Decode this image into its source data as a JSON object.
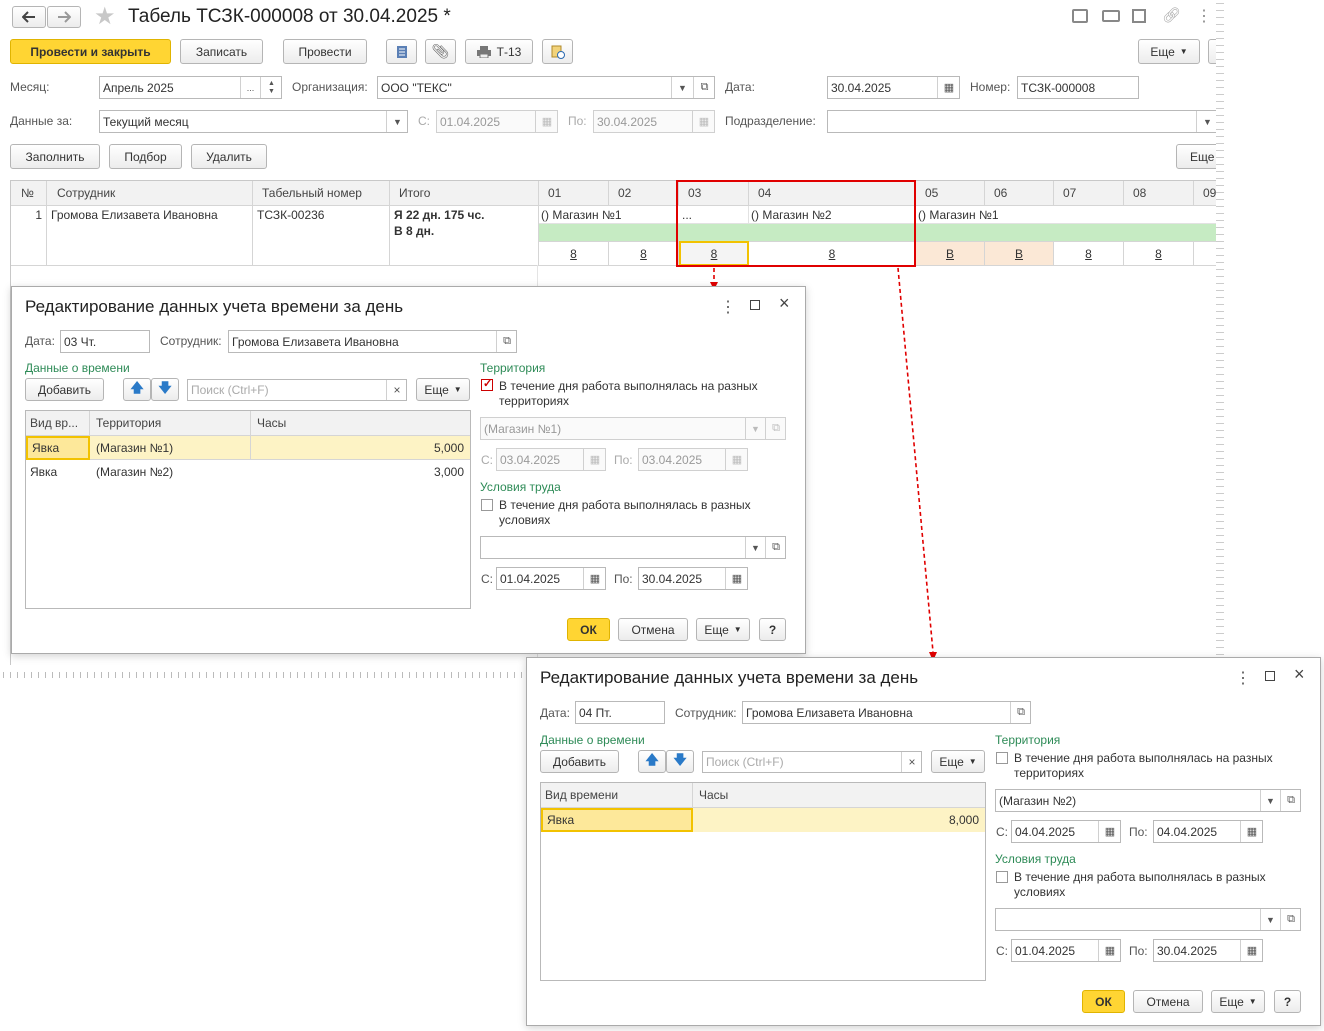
{
  "window": {
    "title": "Табель ТСЗК-000008 от 30.04.2025 *"
  },
  "toolbar": {
    "post_close": "Провести и закрыть",
    "save": "Записать",
    "post": "Провести",
    "t13": "Т-13",
    "more": "Еще"
  },
  "form": {
    "month_label": "Месяц:",
    "month_value": "Апрель 2025",
    "org_label": "Организация:",
    "org_value": "ООО \"ТЕКС\"",
    "date_label": "Дата:",
    "date_value": "30.04.2025",
    "number_label": "Номер:",
    "number_value": "ТСЗК-000008",
    "data_for_label": "Данные за:",
    "data_for_value": "Текущий месяц",
    "from_label": "С:",
    "from_value": "01.04.2025",
    "to_label": "По:",
    "to_value": "30.04.2025",
    "dept_label": "Подразделение:",
    "dept_value": "",
    "ellipsis": "..."
  },
  "table_toolbar": {
    "fill": "Заполнить",
    "select": "Подбор",
    "delete": "Удалить",
    "more": "Еще"
  },
  "table": {
    "headers": [
      "№",
      "Сотрудник",
      "Табельный номер",
      "Итого",
      "01",
      "02",
      "03",
      "04",
      "05",
      "06",
      "07",
      "08",
      "09"
    ],
    "row": {
      "num": "1",
      "employee": "Громова Елизавета Ивановна",
      "tab_num": "ТСЗК-00236",
      "total_line1": "Я 22 дн. 175 чс.",
      "total_line2": "В 8 дн.",
      "territory_1": "() Магазин №1",
      "territory_3": "...",
      "territory_4": "() Магазин №2",
      "territory_5": "() Магазин №1",
      "days": [
        "8",
        "8",
        "8",
        "8",
        "В",
        "В",
        "8",
        "8"
      ]
    }
  },
  "dialog1": {
    "title": "Редактирование данных учета времени за день",
    "date_label": "Дата:",
    "date_value": "03 Чт.",
    "employee_label": "Сотрудник:",
    "employee_value": "Громова Елизавета Ивановна",
    "time_data_label": "Данные о времени",
    "add": "Добавить",
    "search_placeholder": "Поиск (Ctrl+F)",
    "more": "Еще",
    "col_kind": "Вид вр...",
    "col_territory": "Территория",
    "col_hours": "Часы",
    "rows": [
      {
        "kind": "Явка",
        "territory": "(Магазин №1)",
        "hours": "5,000"
      },
      {
        "kind": "Явка",
        "territory": "(Магазин №2)",
        "hours": "3,000"
      }
    ],
    "territory_label": "Территория",
    "territory_check": "В течение дня работа выполнялась на разных территориях",
    "territory_value": "(Магазин №1)",
    "t_from_label": "С:",
    "t_from_value": "03.04.2025",
    "t_to_label": "По:",
    "t_to_value": "03.04.2025",
    "conditions_label": "Условия труда",
    "conditions_check": "В течение дня работа выполнялась в разных условиях",
    "c_from_label": "С:",
    "c_from_value": "01.04.2025",
    "c_to_label": "По:",
    "c_to_value": "30.04.2025",
    "ok": "ОК",
    "cancel": "Отмена",
    "help": "?"
  },
  "dialog2": {
    "title": "Редактирование данных учета времени за день",
    "date_label": "Дата:",
    "date_value": "04 Пт.",
    "employee_label": "Сотрудник:",
    "employee_value": "Громова Елизавета Ивановна",
    "time_data_label": "Данные о времени",
    "add": "Добавить",
    "search_placeholder": "Поиск (Ctrl+F)",
    "more": "Еще",
    "col_kind": "Вид времени",
    "col_hours": "Часы",
    "rows": [
      {
        "kind": "Явка",
        "hours": "8,000"
      }
    ],
    "territory_label": "Территория",
    "territory_check": "В течение дня работа выполнялась на разных территориях",
    "territory_value": "(Магазин №2)",
    "t_from_label": "С:",
    "t_from_value": "04.04.2025",
    "t_to_label": "По:",
    "t_to_value": "04.04.2025",
    "conditions_label": "Условия труда",
    "conditions_check": "В течение дня работа выполнялась в разных условиях",
    "c_from_label": "С:",
    "c_from_value": "01.04.2025",
    "c_to_label": "По:",
    "c_to_value": "30.04.2025",
    "ok": "ОК",
    "cancel": "Отмена",
    "help": "?"
  },
  "colors": {
    "accent_yellow": "#ffd533",
    "highlight_red": "#e00000",
    "green_label": "#2e8b57",
    "weekend_bg": "#fbe8d6",
    "green_band": "#c6ebc3",
    "row_select": "#fdf3c5"
  }
}
